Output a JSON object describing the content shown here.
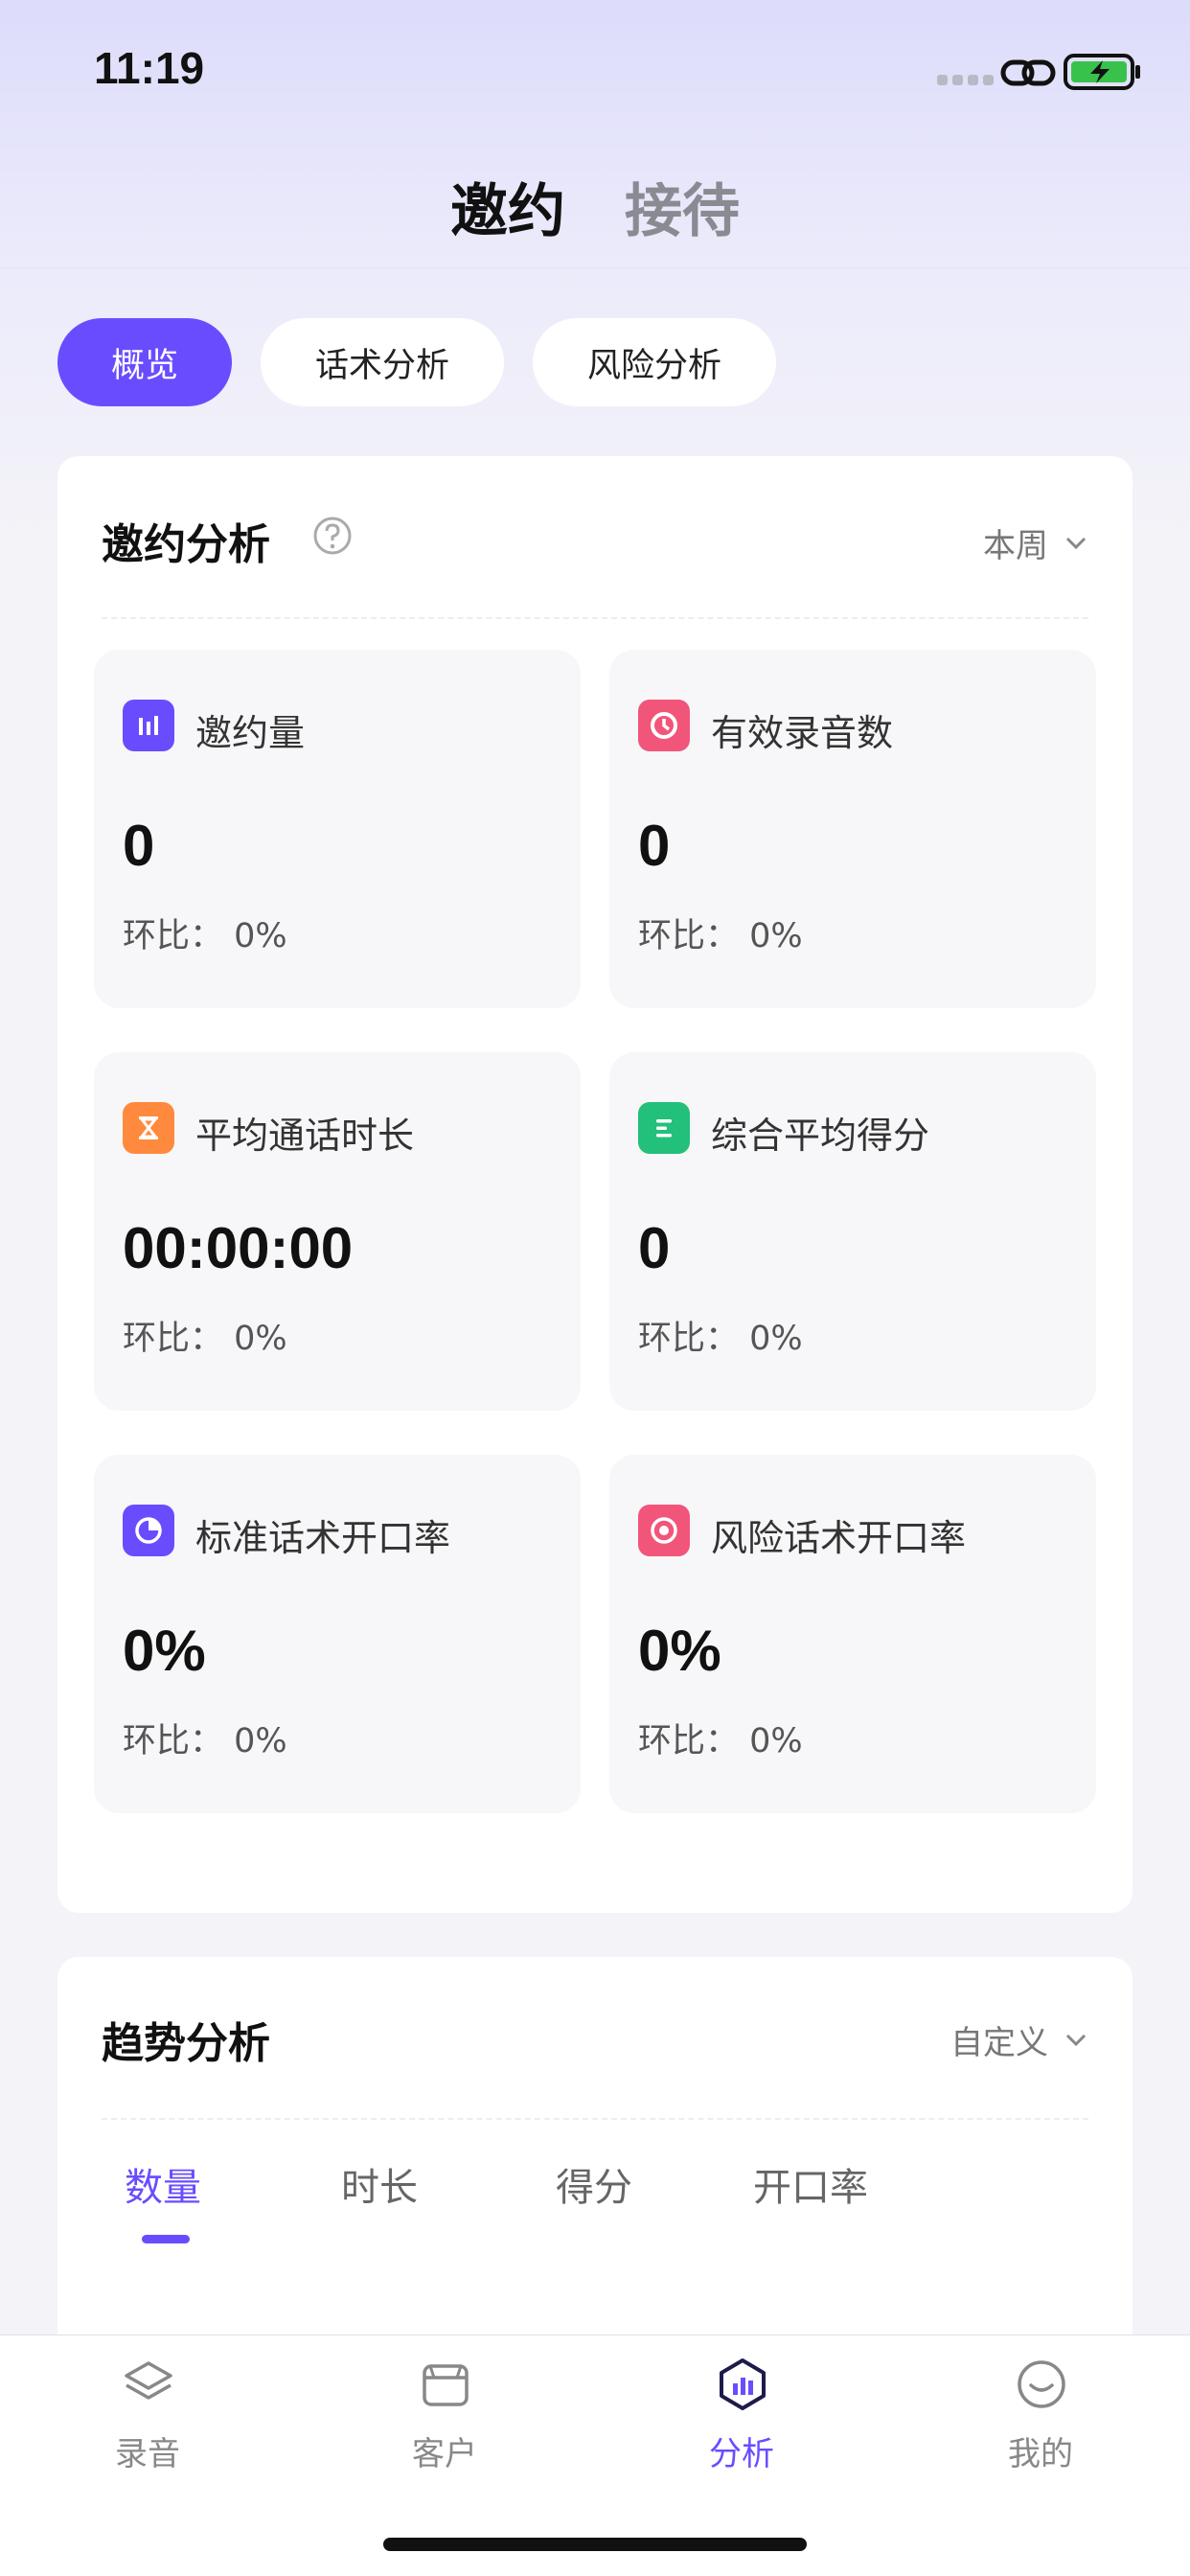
{
  "status_bar": {
    "time": "11:19"
  },
  "header": {
    "tabs": [
      {
        "label": "邀约"
      },
      {
        "label": "接待"
      }
    ]
  },
  "segments": [
    {
      "label": "概览"
    },
    {
      "label": "话术分析"
    },
    {
      "label": "风险分析"
    }
  ],
  "invite_analysis": {
    "title": "邀约分析",
    "period": "本周",
    "stats": [
      {
        "label": "邀约量",
        "value": "0",
        "ratio": "环比：  0%",
        "icon": "bar-chart-icon",
        "color": "#6a4cff"
      },
      {
        "label": "有效录音数",
        "value": "0",
        "ratio": "环比：  0%",
        "icon": "clock-icon",
        "color": "#f2557a"
      },
      {
        "label": "平均通话时长",
        "value": "00:00:00",
        "ratio": "环比：  0%",
        "icon": "hourglass-icon",
        "color": "#ff8a3d"
      },
      {
        "label": "综合平均得分",
        "value": "0",
        "ratio": "环比：  0%",
        "icon": "list-icon",
        "color": "#22c07a"
      },
      {
        "label": "标准话术开口率",
        "value": "0%",
        "ratio": "环比：  0%",
        "icon": "pie-icon",
        "color": "#6a4cff"
      },
      {
        "label": "风险话术开口率",
        "value": "0%",
        "ratio": "环比：  0%",
        "icon": "target-icon",
        "color": "#f2557a"
      }
    ]
  },
  "trend_analysis": {
    "title": "趋势分析",
    "period": "自定义",
    "tabs": [
      {
        "label": "数量"
      },
      {
        "label": "时长"
      },
      {
        "label": "得分"
      },
      {
        "label": "开口率"
      }
    ]
  },
  "bottom_nav": [
    {
      "label": "录音",
      "icon": "layers-icon"
    },
    {
      "label": "客户",
      "icon": "box-icon"
    },
    {
      "label": "分析",
      "icon": "analysis-icon"
    },
    {
      "label": "我的",
      "icon": "profile-icon"
    }
  ],
  "colors": {
    "accent": "#6a4cff"
  }
}
